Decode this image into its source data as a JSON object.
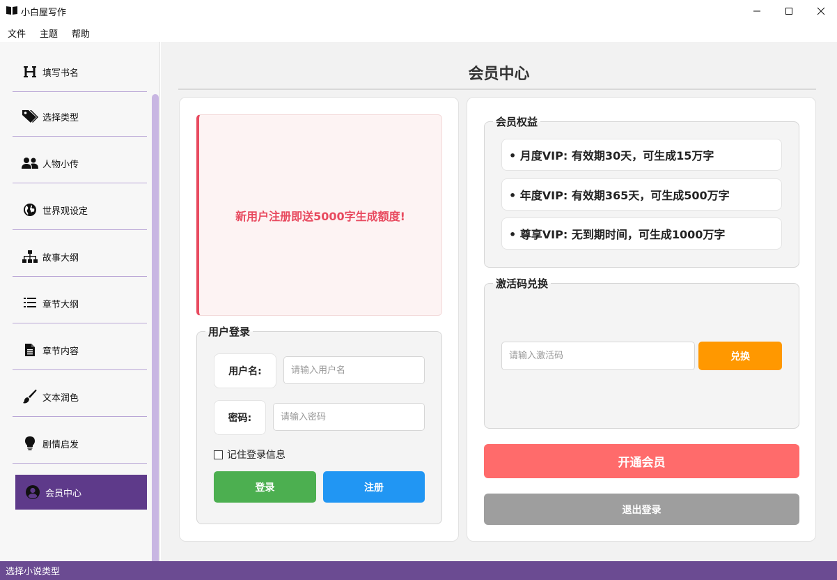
{
  "window": {
    "title": "小白屋写作",
    "controls": {
      "minimize": "—",
      "maximize": "☐",
      "close": "✕"
    }
  },
  "menubar": {
    "items": [
      "文件",
      "主题",
      "帮助"
    ]
  },
  "sidebar": {
    "items": [
      {
        "label": "填写书名",
        "icon": "heading-icon"
      },
      {
        "label": "选择类型",
        "icon": "tags-icon"
      },
      {
        "label": "人物小传",
        "icon": "users-icon"
      },
      {
        "label": "世界观设定",
        "icon": "globe-icon"
      },
      {
        "label": "故事大纲",
        "icon": "sitemap-icon"
      },
      {
        "label": "章节大纲",
        "icon": "numbered-list-icon"
      },
      {
        "label": "章节内容",
        "icon": "file-text-icon"
      },
      {
        "label": "文本润色",
        "icon": "paint-brush-icon"
      },
      {
        "label": "剧情启发",
        "icon": "lightbulb-icon"
      },
      {
        "label": "会员中心",
        "icon": "user-circle-icon",
        "active": true
      }
    ]
  },
  "main": {
    "title": "会员中心",
    "promo": "新用户注册即送5000字生成额度!",
    "login": {
      "group_title": "用户登录",
      "username_label": "用户名:",
      "username_placeholder": "请输入用户名",
      "password_label": "密码:",
      "password_placeholder": "请输入密码",
      "remember": "记住登录信息",
      "remember_checked": false,
      "login_button": "登录",
      "register_button": "注册"
    },
    "benefits": {
      "group_title": "会员权益",
      "items": [
        "• 月度VIP: 有效期30天，可生成15万字",
        "• 年度VIP: 有效期365天，可生成500万字",
        "• 尊享VIP: 无到期时间，可生成1000万字"
      ]
    },
    "redeem": {
      "group_title": "激活码兑换",
      "placeholder": "请输入激活码",
      "button": "兑换"
    },
    "open_button": "开通会员",
    "logout_button": "退出登录"
  },
  "statusbar": {
    "text": "选择小说类型"
  },
  "colors": {
    "accent": "#5e3a8a",
    "statusbar": "#6b4b92",
    "promo_red": "#e84a5f",
    "login_green": "#4caf50",
    "register_blue": "#2196f3",
    "redeem_orange": "#ff9800",
    "open_red": "#ff6b6b",
    "logout_grey": "#9e9e9e"
  }
}
